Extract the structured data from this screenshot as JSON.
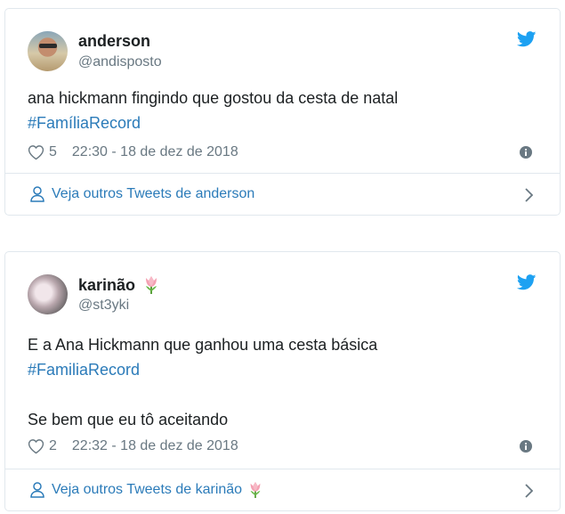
{
  "tweets": [
    {
      "name": "anderson",
      "handle": "@andisposto",
      "text_line": "ana hickmann fingindo que gostou da cesta de natal",
      "hashtag": "#FamíliaRecord",
      "likes": "5",
      "timestamp": "22:30 - 18 de dez de 2018",
      "footer_link": "Veja outros Tweets de anderson",
      "name_emoji": null
    },
    {
      "name": "karinão",
      "handle": "@st3yki",
      "text_line": "E a Ana Hickmann que ganhou uma cesta básica",
      "hashtag": "#FamiliaRecord",
      "text_line_2": "Se bem que eu tô aceitando",
      "likes": "2",
      "timestamp": "22:32 - 18 de dez de 2018",
      "footer_link": "Veja outros Tweets de karinão",
      "name_emoji": "tulip-icon"
    }
  ],
  "colors": {
    "link": "#2b7bb9",
    "twitter_blue": "#1da1f2",
    "muted": "#697882",
    "border": "#e1e8ed"
  },
  "icons": [
    "twitter-bird-icon",
    "heart-icon",
    "info-icon",
    "person-icon",
    "chevron-right-icon",
    "tulip-icon"
  ]
}
